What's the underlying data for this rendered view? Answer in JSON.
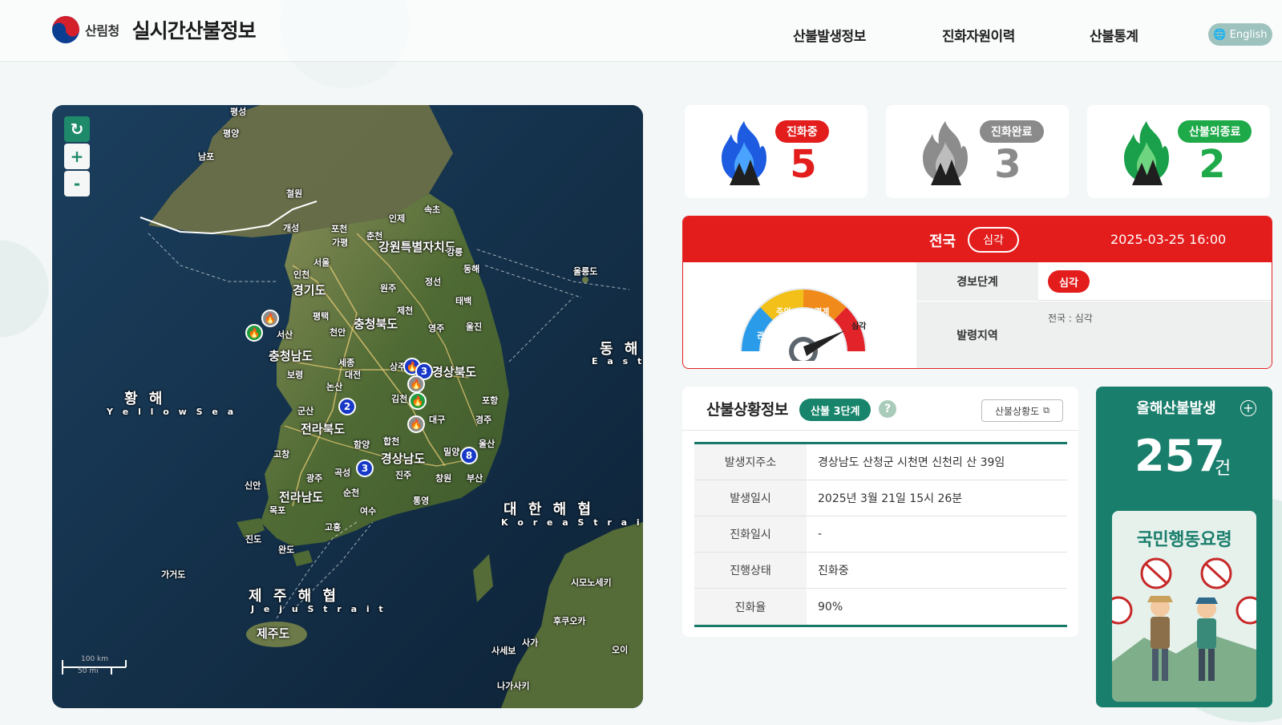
{
  "header": {
    "org": "산림청",
    "title": "실시간산불정보",
    "nav": [
      "산불발생정보",
      "진화자원이력",
      "산불통계"
    ],
    "lang_button": "English"
  },
  "map": {
    "controls": {
      "zoom_in": "+",
      "zoom_out": "-"
    },
    "seas": [
      {
        "ko": "황 해",
        "en": "Y e l l o w  S e a"
      },
      {
        "ko": "대 한 해 협",
        "en": "K o r e a  S t r a i t"
      },
      {
        "ko": "제 주 해 협",
        "en": "J e j u  S t r a i t"
      },
      {
        "ko": "동 해",
        "en": "E a s t"
      }
    ],
    "regions": [
      "강원특별자치도",
      "경기도",
      "충청북도",
      "충청남도",
      "경상북도",
      "전라북도",
      "경상남도",
      "전라남도",
      "제주도"
    ],
    "cities": [
      "평성",
      "평양",
      "남포",
      "철원",
      "개성",
      "포천",
      "춘천",
      "인제",
      "속초",
      "가평",
      "강릉",
      "서울",
      "인천",
      "원주",
      "정선",
      "동해",
      "평택",
      "제천",
      "태백",
      "울릉도",
      "서산",
      "천안",
      "영주",
      "울진",
      "세종",
      "대전",
      "보령",
      "상주",
      "논산",
      "김천",
      "포항",
      "군산",
      "대구",
      "경주",
      "함양",
      "합천",
      "밀양",
      "울산",
      "고창",
      "광주",
      "곡성",
      "진주",
      "창원",
      "부산",
      "신안",
      "순천",
      "통영",
      "목포",
      "여수",
      "고흥",
      "진도",
      "완도",
      "가거도",
      "시모노세키",
      "후쿠오카",
      "사세보",
      "사가",
      "나가사키",
      "오이"
    ],
    "scale": {
      "km": "100 km",
      "mi": "50 mi"
    },
    "markers": [
      {
        "type": "gray",
        "label": ""
      },
      {
        "type": "green",
        "label": ""
      },
      {
        "type": "blue",
        "label": "3"
      },
      {
        "type": "gray",
        "label": ""
      },
      {
        "type": "green",
        "label": ""
      },
      {
        "type": "gray",
        "label": ""
      },
      {
        "type": "blue",
        "label": "2"
      },
      {
        "type": "blue",
        "label": "3"
      },
      {
        "type": "blue",
        "label": "8"
      }
    ]
  },
  "stats": [
    {
      "label": "진화중",
      "value": "5",
      "color": "#e31c1c"
    },
    {
      "label": "진화완료",
      "value": "3",
      "color": "#8a8a8a"
    },
    {
      "label": "산불외종료",
      "value": "2",
      "color": "#1faa4a"
    }
  ],
  "alert": {
    "region": "전국",
    "level": "심각",
    "datetime": "2025-03-25 16:00",
    "gauge_labels": [
      "관심",
      "주의",
      "경계",
      "심각"
    ],
    "rows": {
      "stage_label": "경보단계",
      "stage_value": "심각",
      "area_label": "발령지역",
      "area_value": "전국 : 심각"
    }
  },
  "fire_info": {
    "title": "산불상황정보",
    "stage": "산불 3단계",
    "help": "?",
    "status_button": "산불상황도",
    "rows": [
      {
        "label": "발생지주소",
        "value": "경상남도 산청군 시천면 신천리 산 39임"
      },
      {
        "label": "발생일시",
        "value": "2025년 3월 21일 15시 26분"
      },
      {
        "label": "진화일시",
        "value": "-"
      },
      {
        "label": "진행상태",
        "value": "진화중"
      },
      {
        "label": "진화율",
        "value": "90%"
      }
    ]
  },
  "annual": {
    "title": "올해산불발생",
    "plus": "+",
    "count": "257",
    "unit": "건",
    "card_title": "국민행동요령"
  }
}
